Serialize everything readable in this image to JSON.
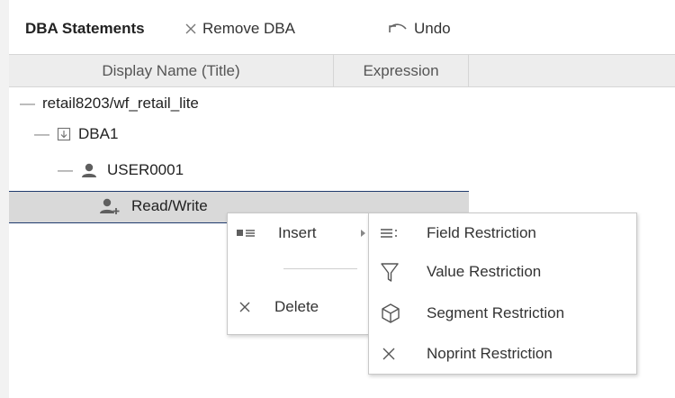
{
  "toolbar": {
    "title": "DBA Statements",
    "remove_label": "Remove DBA",
    "undo_label": "Undo"
  },
  "columns": [
    "Display Name (Title)",
    "Expression"
  ],
  "tree": {
    "root": "retail8203/wf_retail_lite",
    "dba": "DBA1",
    "user": "USER0001",
    "access": "Read/Write"
  },
  "context_menu": {
    "insert_label": "Insert",
    "delete_label": "Delete"
  },
  "submenu": {
    "items": [
      {
        "label": "Field Restriction",
        "icon": "field-restriction-icon"
      },
      {
        "label": "Value Restriction",
        "icon": "filter-icon"
      },
      {
        "label": "Segment Restriction",
        "icon": "cube-icon"
      },
      {
        "label": "Noprint Restriction",
        "icon": "close-icon"
      }
    ]
  },
  "colors": {
    "selection_border": "#203b6e",
    "selection_bg": "#d9d9d9",
    "header_bg": "#ededed"
  }
}
